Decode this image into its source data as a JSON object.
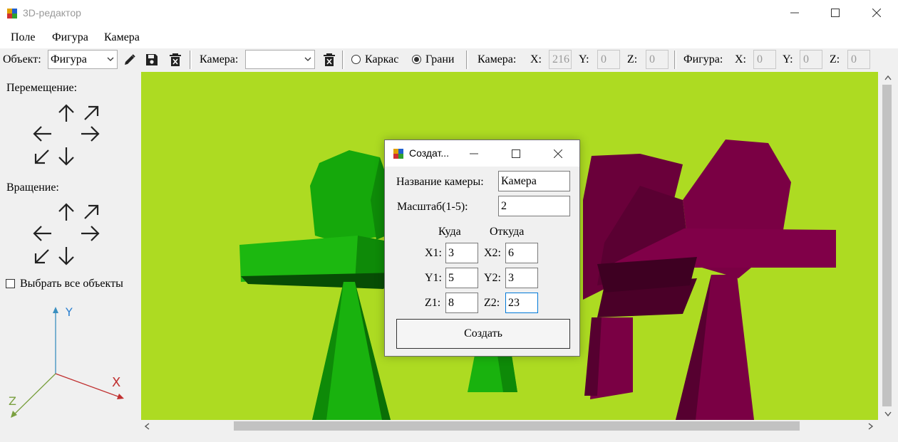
{
  "window": {
    "title": "3D-редактор"
  },
  "menu": [
    "Поле",
    "Фигура",
    "Камера"
  ],
  "toolbar": {
    "object_label": "Объект:",
    "object_value": "Фигура",
    "camera_label": "Камера:",
    "camera_value": "",
    "mode_wireframe": "Каркас",
    "mode_faces": "Грани",
    "mode_selected": "Грани",
    "camera_coords_label": "Камера:",
    "camera_coords": {
      "x_label": "X:",
      "x": "216",
      "y_label": "Y:",
      "y": "0",
      "z_label": "Z:",
      "z": "0"
    },
    "figure_coords_label": "Фигура:",
    "figure_coords": {
      "x_label": "X:",
      "x": "0",
      "y_label": "Y:",
      "y": "0",
      "z_label": "Z:",
      "z": "0"
    }
  },
  "left_panel": {
    "move_label": "Перемещение:",
    "rotate_label": "Вращение:",
    "select_all_label": "Выбрать все объекты",
    "select_all_checked": false,
    "axes": {
      "x": "X",
      "y": "Y",
      "z": "Z"
    }
  },
  "dialog": {
    "title": "Создат...",
    "camera_name_label": "Название камеры:",
    "camera_name": "Камера",
    "scale_label": "Масштаб(1-5):",
    "scale": "2",
    "to_header": "Куда",
    "from_header": "Откуда",
    "x1_label": "X1:",
    "x1": "3",
    "y1_label": "Y1:",
    "y1": "5",
    "z1_label": "Z1:",
    "z1": "8",
    "x2_label": "X2:",
    "x2": "6",
    "y2_label": "Y2:",
    "y2": "3",
    "z2_label": "Z2:",
    "z2": "23",
    "create_button": "Создать"
  },
  "colors": {
    "viewport_background": "#addb22",
    "green_figure": "#19b20e",
    "maroon_figure": "#7a0044",
    "axis_x": "#c03030",
    "axis_y": "#3a8fc0",
    "axis_z": "#7aa040"
  }
}
